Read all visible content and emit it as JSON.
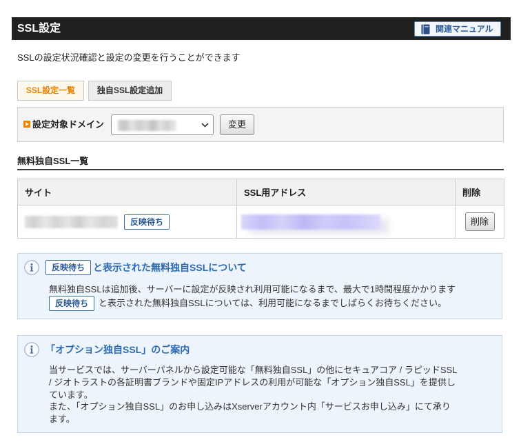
{
  "header": {
    "title": "SSL設定",
    "manual_button": "関連マニュアル"
  },
  "description": "SSLの設定状況確認と設定の変更を行うことができます",
  "tabs": [
    {
      "label": "SSL設定一覧",
      "active": true
    },
    {
      "label": "独自SSL設定追加",
      "active": false
    }
  ],
  "domain_selector": {
    "label": "設定対象ドメイン",
    "change_button": "変更"
  },
  "ssl_list": {
    "heading": "無料独自SSL一覧",
    "columns": [
      "サイト",
      "SSL用アドレス",
      "削除"
    ],
    "rows": [
      {
        "status_badge": "反映待ち",
        "delete_button": "削除"
      }
    ]
  },
  "info_pending": {
    "title_badge": "反映待ち",
    "title_text": "と表示された無料独自SSLについて",
    "line1": "無料独自SSLは追加後、サーバーに設定が反映され利用可能になるまで、最大で1時間程度かかります",
    "line2_badge": "反映待ち",
    "line2_text": "と表示された無料独自SSLについては、利用可能になるまでしばらくお待ちください。"
  },
  "info_option_ssl": {
    "title": "「オプション独自SSL」のご案内",
    "lines": [
      "当サービスでは、サーバーパネルから設定可能な「無料独自SSL」の他にセキュアコア / ラピッドSSL",
      "/ ジオトラストの各証明書ブランドや固定IPアドレスの利用が可能な「オプション独自SSL」を提供し",
      "ています。",
      "また、「オプション独自SSL」のお申し込みはXserverアカウント内「サービスお申し込み」にて承り",
      "ます。"
    ]
  },
  "icons": {
    "manual_button": "book-icon",
    "domain_label_bullet": "orange-arrow-bullet-icon",
    "select_toggle": "chevron-down-icon",
    "info": "info-icon"
  },
  "colors": {
    "header_bg": "#202020",
    "accent_orange": "#f08300",
    "title_blue": "#2c6bb3",
    "badge_blue": "#3a6ca6",
    "info_bg": "#eef4fb",
    "info_border": "#c6d6e8"
  }
}
